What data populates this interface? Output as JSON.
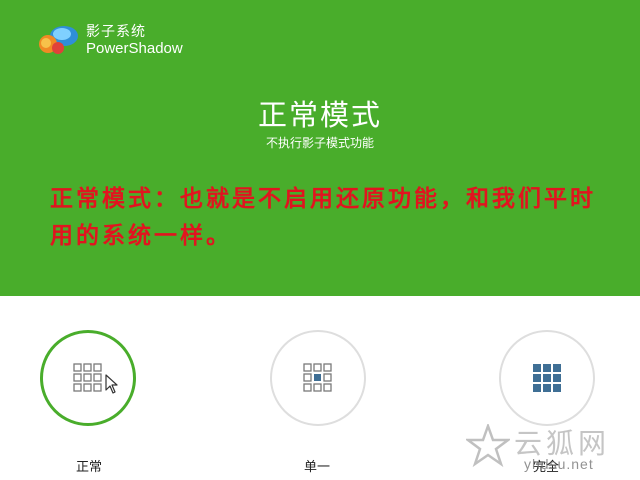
{
  "brand": {
    "name_cn": "影子系统",
    "name_en": "PowerShadow"
  },
  "header": {
    "title": "正常模式",
    "subtitle": "不执行影子模式功能"
  },
  "annotation": {
    "text": "正常模式：也就是不启用还原功能，和我们平时用的系统一样。",
    "color": "#e1141f"
  },
  "modes": [
    {
      "label": "正常",
      "icon": "grid-empty-icon",
      "selected": true
    },
    {
      "label": "单一",
      "icon": "grid-center-icon",
      "selected": false
    },
    {
      "label": "完全",
      "icon": "grid-full-icon",
      "selected": false
    }
  ],
  "watermark": {
    "text": "云狐网",
    "url": "yhdsu.net"
  },
  "colors": {
    "accent": "#49ad2b",
    "icon": "#7a7a7a",
    "icon_fill": "#3f6f95"
  }
}
